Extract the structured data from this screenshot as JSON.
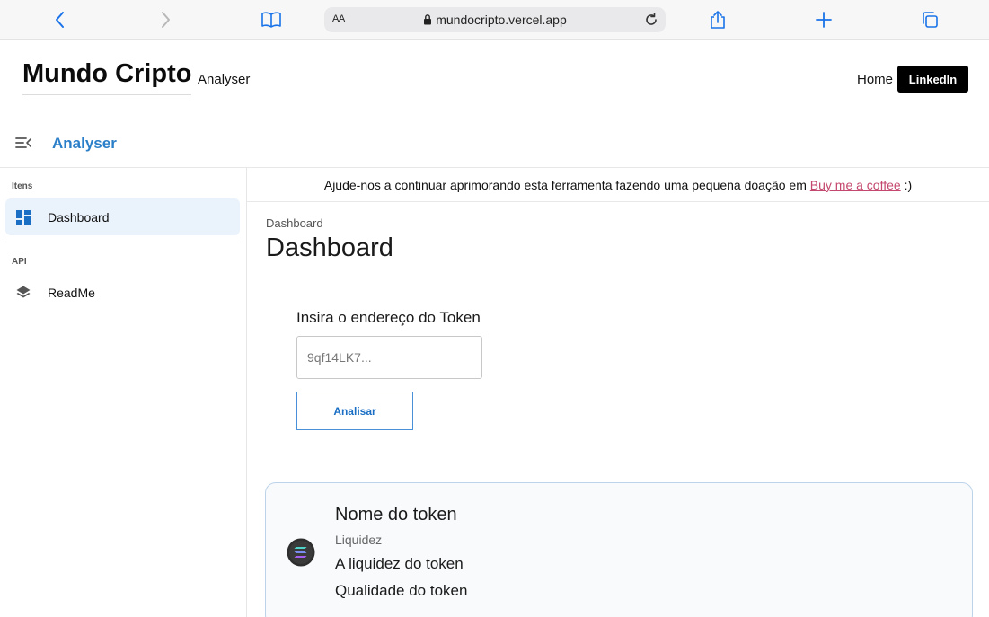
{
  "browser": {
    "text_size_label": "AA",
    "url": "mundocripto.vercel.app",
    "icons": [
      "back-icon",
      "forward-icon",
      "book-icon",
      "lock-icon",
      "reload-icon",
      "share-icon",
      "plus-icon",
      "tabs-icon"
    ]
  },
  "header": {
    "title": "Mundo Cripto",
    "subtitle": "Analyser",
    "nav": {
      "home": "Home",
      "linkedin": "LinkedIn"
    }
  },
  "appbar": {
    "title": "Analyser",
    "menu_icon": "menu-collapse-icon"
  },
  "sidebar": {
    "sections": [
      {
        "title": "Itens",
        "items": [
          {
            "label": "Dashboard",
            "icon": "dashboard-icon",
            "active": true
          }
        ]
      },
      {
        "title": "API",
        "items": [
          {
            "label": "ReadMe",
            "icon": "layers-icon",
            "active": false
          }
        ]
      }
    ]
  },
  "banner": {
    "text": "Ajude-nos a continuar aprimorando esta ferramenta fazendo uma pequena doação em ",
    "link": "Buy me a coffee",
    "suffix": " :)"
  },
  "main": {
    "breadcrumb": "Dashboard",
    "title": "Dashboard",
    "form": {
      "label": "Insira o endereço do Token",
      "placeholder": "9qf14LK7...",
      "button": "Analisar"
    },
    "token_card": {
      "name": "Nome do token",
      "liquidity_label": "Liquidez",
      "liquidity": "A liquidez do token",
      "quality": "Qualidade do token",
      "logo_icon": "solana-icon"
    }
  },
  "colors": {
    "accent": "#2b7fc9",
    "link": "#c4486e",
    "card_border": "#bcd3ea",
    "active_item_bg": "#eaf2fc"
  }
}
